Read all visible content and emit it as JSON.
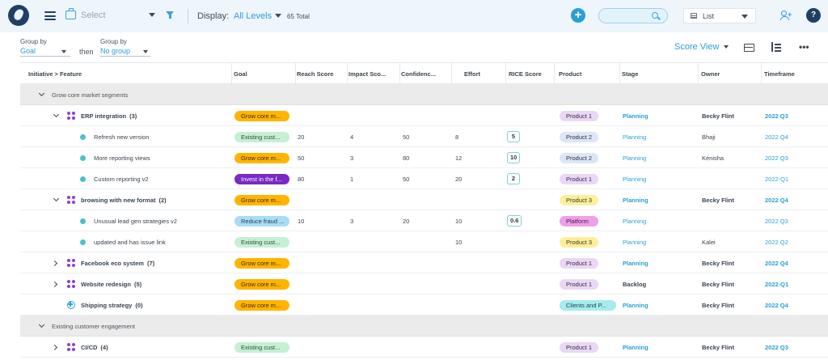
{
  "topbar": {
    "select_placeholder": "Select",
    "display_label": "Display:",
    "display_value": "All Levels",
    "total": "65 Total",
    "view_value": "List",
    "help": "?",
    "add": "+"
  },
  "toolbar": {
    "group_by_label": "Group by",
    "group_by_value": "Goal",
    "then_label": "then",
    "group_by2_label": "Group by",
    "group_by2_value": "No group",
    "score_view": "Score View",
    "more": "•••"
  },
  "columns": [
    "Initiative > Feature",
    "Goal",
    "Reach Score",
    "Impact Sco...",
    "Confidenc...",
    "Effort",
    "RICE Score",
    "Product",
    "Stage",
    "Owner",
    "Timeframe"
  ],
  "colors": {
    "accent": "#2a9fd6",
    "navy": "#1f3f66",
    "goal_growth": "#ffb400",
    "goal_existing": "#c6efd3",
    "goal_invest": "#7a29c4",
    "goal_reduce": "#a9dcf6",
    "product_1": "#e9d7f5",
    "product_2": "#dce6f6",
    "product_3": "#fcef9c",
    "platform": "#ef9ee8",
    "clients": "#a6ebef"
  },
  "rows": [
    {
      "type": "group",
      "expanded": true,
      "name": "Grow core market segments"
    },
    {
      "type": "initiative",
      "expanded": true,
      "icon": "initiative-icon",
      "name": "ERP integration",
      "count": "(3)",
      "goal": "Grow core m...",
      "goal_style": "growth",
      "reach": "",
      "impact": "",
      "confidence": "",
      "effort": "",
      "rice": "",
      "product": "Product 1",
      "product_style": "p1",
      "stage": "Planning",
      "owner": "Becky Flint",
      "timeframe": "2022 Q3"
    },
    {
      "type": "feature",
      "name": "Refresh new version",
      "goal": "Existing cust...",
      "goal_style": "existing",
      "reach": "20",
      "impact": "4",
      "confidence": "50",
      "effort": "8",
      "rice": "5",
      "product": "Product 2",
      "product_style": "p2",
      "stage": "Planning",
      "owner": "Bhaji",
      "timeframe": "2022 Q4"
    },
    {
      "type": "feature",
      "name": "More reporting views",
      "goal": "Grow core m...",
      "goal_style": "growth",
      "reach": "50",
      "impact": "3",
      "confidence": "80",
      "effort": "12",
      "rice": "10",
      "product": "Product 2",
      "product_style": "p2",
      "stage": "Planning",
      "owner": "Kenisha",
      "timeframe": "2022 Q3"
    },
    {
      "type": "feature",
      "name": "Custom reporting v2",
      "goal": "Invest in the f...",
      "goal_style": "invest",
      "reach": "80",
      "impact": "1",
      "confidence": "50",
      "effort": "20",
      "rice": "2",
      "product": "Product 1",
      "product_style": "p1",
      "stage": "Planning",
      "owner": "",
      "timeframe": "2022-Q1"
    },
    {
      "type": "initiative",
      "expanded": true,
      "icon": "initiative-icon",
      "name": "browsing with new format",
      "count": "(2)",
      "goal": "Grow core m...",
      "goal_style": "growth",
      "reach": "",
      "impact": "",
      "confidence": "",
      "effort": "",
      "rice": "",
      "product": "Product 3",
      "product_style": "p3",
      "stage": "Planning",
      "owner": "Becky Flint",
      "timeframe": "2022 Q4"
    },
    {
      "type": "feature",
      "name": "Unusual lead gen strategies v2",
      "goal": "Reduce fraud ...",
      "goal_style": "reduce",
      "reach": "10",
      "impact": "3",
      "confidence": "20",
      "effort": "10",
      "rice": "0.6",
      "product": "Platform",
      "product_style": "platform",
      "stage": "Planning",
      "owner": "",
      "timeframe": "2022 Q3"
    },
    {
      "type": "feature",
      "name": "updated and has issue link",
      "goal": "Existing cust...",
      "goal_style": "existing",
      "reach": "",
      "impact": "",
      "confidence": "",
      "effort": "10",
      "rice": "",
      "product": "Product 3",
      "product_style": "p3",
      "stage": "Planning",
      "owner": "Kalei",
      "timeframe": "2022 Q2"
    },
    {
      "type": "initiative",
      "expanded": false,
      "icon": "initiative-icon",
      "name": "Facebook eco system",
      "count": "(7)",
      "goal": "Grow core m...",
      "goal_style": "growth",
      "reach": "",
      "impact": "",
      "confidence": "",
      "effort": "",
      "rice": "",
      "product": "Product 1",
      "product_style": "p1",
      "stage": "Planning",
      "owner": "Becky Flint",
      "timeframe": "2022 Q4"
    },
    {
      "type": "initiative",
      "expanded": false,
      "icon": "initiative-icon",
      "name": "Website redesign",
      "count": "(5)",
      "goal": "Grow core m...",
      "goal_style": "growth",
      "reach": "",
      "impact": "",
      "confidence": "",
      "effort": "",
      "rice": "",
      "product": "Product 1",
      "product_style": "p1",
      "stage": "Backlog",
      "owner": "Becky Flint",
      "timeframe": "2022-Q1"
    },
    {
      "type": "initiative",
      "expanded": null,
      "icon": "plus-circle-icon",
      "name": "Shipping strategy",
      "count": "(0)",
      "goal": "Grow core m...",
      "goal_style": "growth",
      "reach": "",
      "impact": "",
      "confidence": "",
      "effort": "",
      "rice": "",
      "product": "Clients and P...",
      "product_style": "clients",
      "stage": "Planning",
      "owner": "Becky Flint",
      "timeframe": "2022 Q4"
    },
    {
      "type": "group",
      "expanded": true,
      "name": "Existing customer engagement"
    },
    {
      "type": "initiative",
      "expanded": false,
      "icon": "initiative-icon",
      "name": "CI/CD",
      "count": "(4)",
      "goal": "Existing cust...",
      "goal_style": "existing",
      "reach": "",
      "impact": "",
      "confidence": "",
      "effort": "",
      "rice": "",
      "product": "Product 1",
      "product_style": "p1",
      "stage": "Planning",
      "owner": "Becky Flint",
      "timeframe": "2022 Q3"
    }
  ]
}
